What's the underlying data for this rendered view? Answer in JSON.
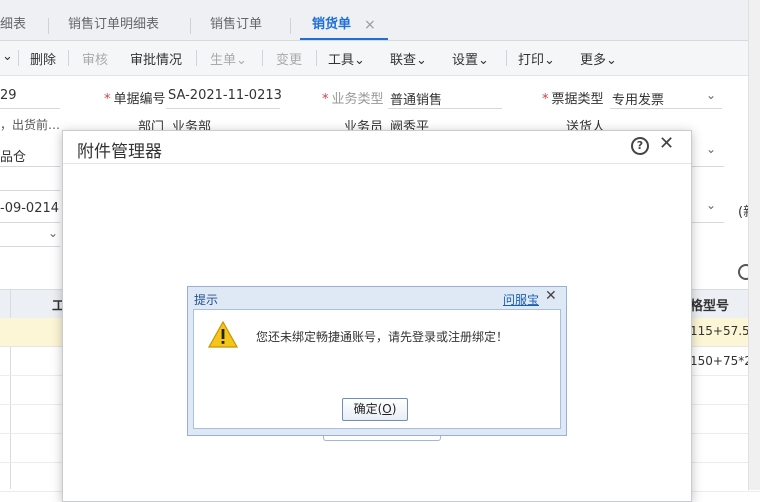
{
  "tabs": [
    {
      "label": "细表",
      "active": false
    },
    {
      "label": "销售订单明细表",
      "active": false
    },
    {
      "label": "销售订单",
      "active": false
    },
    {
      "label": "销货单",
      "active": true
    }
  ],
  "tab_close": "×",
  "toolbar": {
    "delete": "删除",
    "audit": "审核",
    "approval": "审批情况",
    "generate": "生单",
    "change": "变更",
    "tools": "工具",
    "linked": "联查",
    "settings": "设置",
    "print": "打印",
    "more": "更多"
  },
  "form": {
    "left_value_1": "29",
    "left_value_2": "，出货前…",
    "left_value_3": "品仓",
    "left_value_4": "-09-0214",
    "doc_no_label": "单据编号",
    "doc_no_value": "SA-2021-11-0213",
    "biz_type_label": "业务类型",
    "biz_type_value": "普通销售",
    "invoice_type_label": "票据类型",
    "invoice_type_value": "专用发票",
    "dept_label": "部门",
    "dept_value": "业务部",
    "salesman_label": "业务员",
    "salesman_value": "阙秀平",
    "deliverer_label": "送货人",
    "right_partial": "(新"
  },
  "grid": {
    "col_left": "工",
    "col_spec": "格型号",
    "rows": [
      "115+57.5…",
      "150+75*2…"
    ]
  },
  "attachment_dialog": {
    "title": "附件管理器",
    "help_icon": "question-circle-icon",
    "close_icon": "close-icon"
  },
  "alert": {
    "title": "提示",
    "help_link": "问服宝",
    "message": "您还未绑定畅捷通账号，请先登录或注册绑定！",
    "ok_label": "确定(",
    "ok_key": "O",
    "ok_suffix": ")",
    "icon": "warning-icon"
  },
  "colors": {
    "accent": "#1e70d8",
    "required": "#e0393e",
    "row_highlight": "#fdf6d6"
  }
}
